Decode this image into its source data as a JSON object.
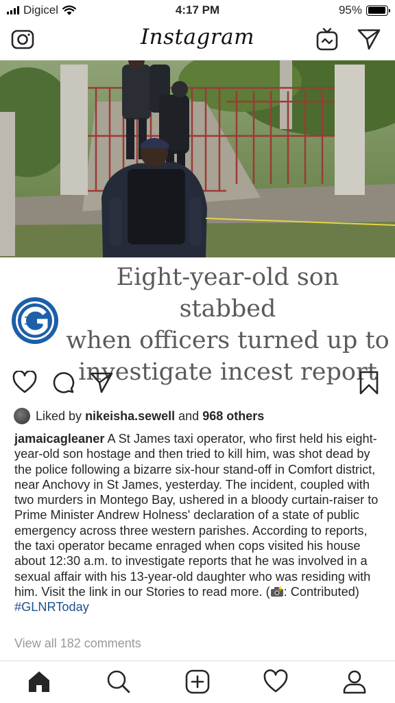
{
  "status_bar": {
    "carrier": "Digicel",
    "time": "4:17 PM",
    "battery_text": "95%",
    "battery_level": 0.95
  },
  "top_nav": {
    "logo": "Instagram",
    "icons": [
      "camera-icon",
      "igtv-icon",
      "direct-message-icon"
    ]
  },
  "post": {
    "headline": "Eight-year-old son stabbed when officers turned up to investigate incest report",
    "headline_lines": [
      "Eight-year-old son stabbed",
      "when officers turned up to",
      "investigate incest report"
    ],
    "likes": {
      "prefix": "Liked by",
      "liked_by_user": "nikeisha.sewell",
      "connector": "and",
      "others": "968 others"
    },
    "caption": {
      "username": "jamaicagleaner",
      "text": " A St James taxi operator, who first held his eight-year-old son hostage and then tried to kill him, was shot dead by the police following a bizarre six-hour stand-off in Comfort district, near Anchovy in St James, yesterday. The incident, coupled with two murders in Montego Bay, ushered in a bloody curtain-raiser to Prime Minister Andrew Holness' declaration of a state of public emergency across three western parishes. According to reports, the taxi operator became enraged when cops visited his house about 12:30 a.m. to investigate reports that he was involved in a sexual affair with his 13-year-old daughter who was residing with him. Visit the link in our Stories to read more. (",
      "emoji": "camera-with-flash",
      "after_emoji": ": Contributed) ",
      "hashtag": "#GLNRToday"
    },
    "view_comments": "View all 182 comments"
  },
  "action_icons": [
    "heart-icon",
    "comment-icon",
    "share-icon",
    "bookmark-icon"
  ],
  "tab_bar": [
    "home-icon",
    "search-icon",
    "new-post-icon",
    "activity-icon",
    "profile-icon"
  ],
  "colors": {
    "hashtag": "#1f4f8b",
    "gleaner_blue": "#1d5fa8",
    "muted_text": "#999999",
    "headline_text": "#5a5a5a"
  }
}
